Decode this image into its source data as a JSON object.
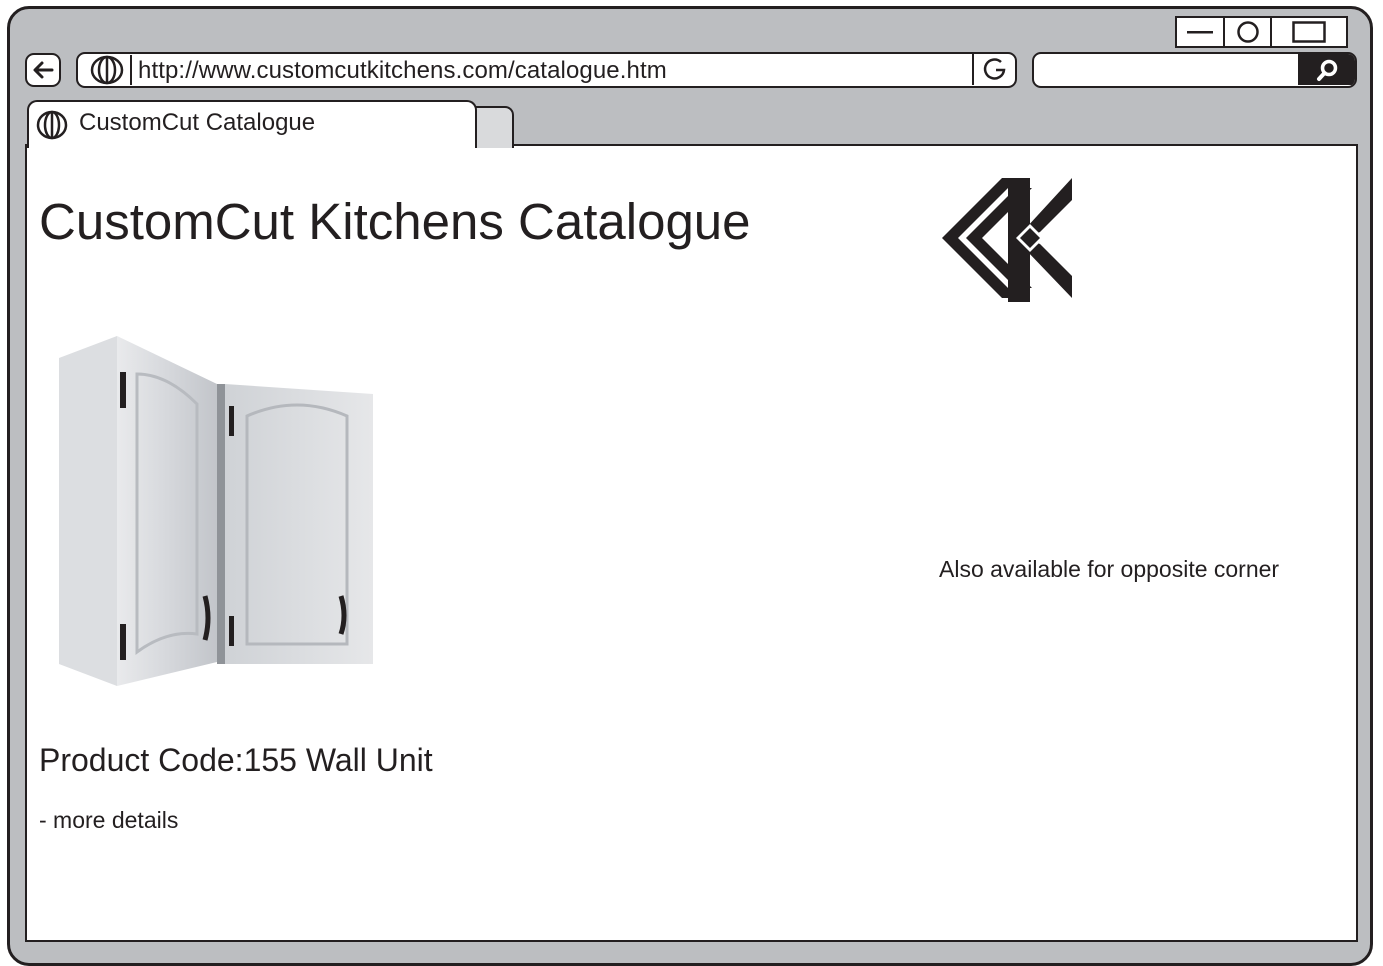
{
  "browser": {
    "url": "http://www.customcutkitchens.com/catalogue.htm",
    "search_value": "",
    "tab_title": "CustomCut Catalogue"
  },
  "window_controls": {
    "icons": [
      "minimize-icon",
      "restore-icon",
      "maximize-icon"
    ]
  },
  "page": {
    "title": "CustomCut Kitchens Catalogue",
    "logo": "customcut-kitchens-logo",
    "product_image": "corner wall cabinet",
    "side_note": "Also available for opposite corner",
    "product_code": "Product Code:155 Wall Unit",
    "more_details": "- more details"
  },
  "colors": {
    "chrome": "#bcbec1",
    "ink": "#231f20",
    "content_bg": "#ffffff"
  }
}
